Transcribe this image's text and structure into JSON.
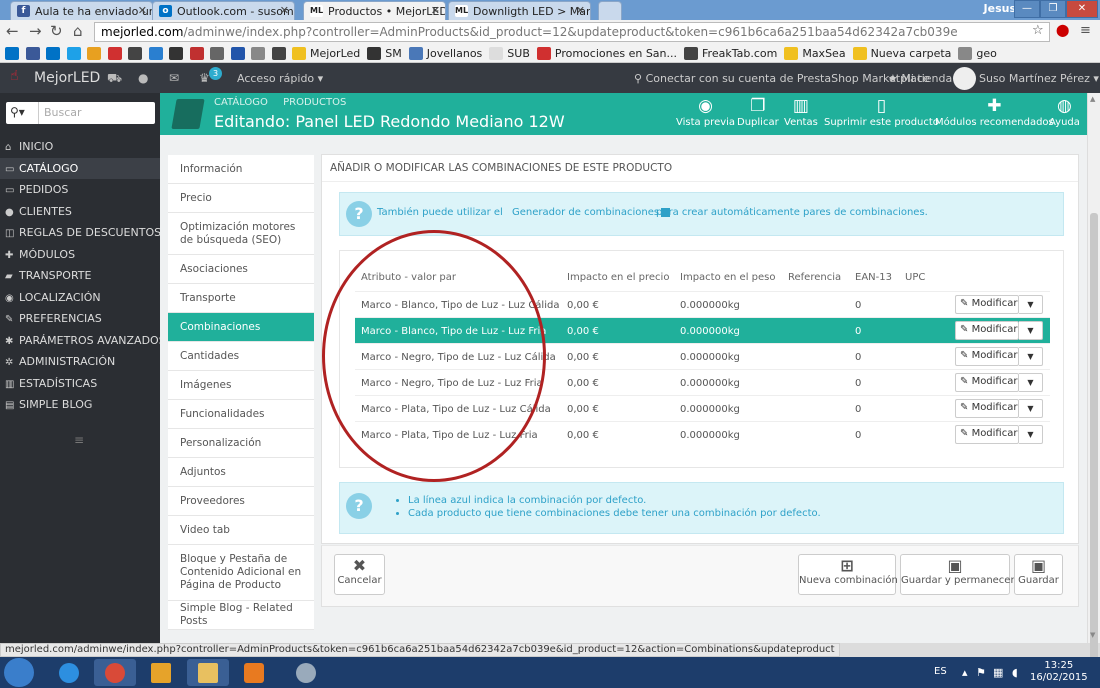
{
  "browser": {
    "tabs": [
      {
        "label": "Aula te ha enviado un me",
        "icon": "facebook-icon",
        "color": "#3b5998",
        "glyph": "f"
      },
      {
        "label": "Outlook.com - susomarp",
        "icon": "outlook-icon",
        "color": "#0072c6",
        "glyph": "o"
      },
      {
        "label": "Productos • MejorLED",
        "icon": "mejorled-icon",
        "color": "#ffffff",
        "glyph": "ML",
        "active": true
      },
      {
        "label": "Downligth LED > Marco b",
        "icon": "mejorled-icon",
        "color": "#ffffff",
        "glyph": "ML"
      }
    ],
    "window_user": "Jesus",
    "url": {
      "host": "mejorled.com",
      "rest": "/adminwe/index.php?controller=AdminProducts&id_product=12&updateproduct&token=c961b6ca6a251baa54d62342a7cb039e"
    },
    "bookmarks": [
      {
        "label": "MejorLed",
        "color": "#f0c020"
      },
      {
        "label": "SM",
        "color": "#333333"
      },
      {
        "label": "Jovellanos",
        "color": "#4a78b8"
      },
      {
        "label": "SUB",
        "color": "#dddddd"
      },
      {
        "label": "Promociones en San...",
        "color": "#d03030"
      },
      {
        "label": "FreakTab.com",
        "color": "#444444"
      },
      {
        "label": "MaxSea",
        "color": "#f0c020"
      },
      {
        "label": "Nueva carpeta",
        "color": "#f0c020"
      },
      {
        "label": "geo",
        "color": "#888888"
      }
    ],
    "status_url": "mejorled.com/adminwe/index.php?controller=AdminProducts&token=c961b6ca6a251baa54d62342a7cb039e&id_product=12&action=Combinations&updateproduct"
  },
  "header": {
    "shop_name": "MejorLED",
    "badge": "3",
    "quick_access": "Acceso rápido",
    "connect": "Conectar con su cuenta de PrestaShop Marketplace",
    "my_store": "Mi tienda",
    "user": "Suso Martínez Pérez"
  },
  "sidebar": {
    "search_placeholder": "Buscar",
    "items": [
      {
        "label": "INICIO",
        "icon": "home-icon",
        "glyph": "⌂"
      },
      {
        "label": "CATÁLOGO",
        "icon": "catalog-icon",
        "glyph": "▭",
        "active": true
      },
      {
        "label": "PEDIDOS",
        "icon": "credit-card-icon",
        "glyph": "▭"
      },
      {
        "label": "CLIENTES",
        "icon": "users-icon",
        "glyph": "●"
      },
      {
        "label": "REGLAS DE DESCUENTOS",
        "icon": "discount-icon",
        "glyph": "◫"
      },
      {
        "label": "MÓDULOS",
        "icon": "puzzle-icon",
        "glyph": "✚"
      },
      {
        "label": "TRANSPORTE",
        "icon": "truck-icon",
        "glyph": "▰"
      },
      {
        "label": "LOCALIZACIÓN",
        "icon": "globe-icon",
        "glyph": "◉"
      },
      {
        "label": "PREFERENCIAS",
        "icon": "wrench-icon",
        "glyph": "✎"
      },
      {
        "label": "PARÁMETROS AVANZADOS",
        "icon": "cogs-icon",
        "glyph": "✱"
      },
      {
        "label": "ADMINISTRACIÓN",
        "icon": "cog-icon",
        "glyph": "✲"
      },
      {
        "label": "ESTADÍSTICAS",
        "icon": "bar-chart-icon",
        "glyph": "▥"
      },
      {
        "label": "SIMPLE BLOG",
        "icon": "blog-icon",
        "glyph": "▤"
      }
    ]
  },
  "page": {
    "breadcrumb": [
      "CATÁLOGO",
      "PRODUCTOS"
    ],
    "title": "Editando: Panel LED Redondo Mediano 12W",
    "toolbar": [
      {
        "label": "Vista previa",
        "icon": "eye-icon",
        "glyph": "◉"
      },
      {
        "label": "Duplicar",
        "icon": "copy-icon",
        "glyph": "❐"
      },
      {
        "label": "Ventas",
        "icon": "bar-chart-icon",
        "glyph": "▥"
      },
      {
        "label": "Suprimir este producto",
        "icon": "trash-icon",
        "glyph": "▯"
      },
      {
        "label": "Módulos recomendados",
        "icon": "puzzle-icon",
        "glyph": "✚"
      },
      {
        "label": "Ayuda",
        "icon": "help-icon",
        "glyph": "◍"
      }
    ]
  },
  "subtabs": [
    {
      "label": "Información"
    },
    {
      "label": "Precio"
    },
    {
      "label": "Optimización motores de búsqueda (SEO)"
    },
    {
      "label": "Asociaciones"
    },
    {
      "label": "Transporte"
    },
    {
      "label": "Combinaciones",
      "active": true
    },
    {
      "label": "Cantidades"
    },
    {
      "label": "Imágenes"
    },
    {
      "label": "Funcionalidades"
    },
    {
      "label": "Personalización"
    },
    {
      "label": "Adjuntos"
    },
    {
      "label": "Proveedores"
    },
    {
      "label": "Video tab"
    },
    {
      "label": "Bloque y Pestaña de Contenido Adicional en Página de Producto"
    },
    {
      "label": "Simple Blog - Related Posts"
    }
  ],
  "panel": {
    "title": "AÑADIR O MODIFICAR LAS COMBINACIONES DE ESTE PRODUCTO",
    "info_text": "También puede utilizar el",
    "info_link": "Generador de combinaciones",
    "info_text2": "para crear automáticamente pares de combinaciones.",
    "columns": [
      "Atributo - valor par",
      "Impacto en el precio",
      "Impacto en el peso",
      "Referencia",
      "EAN-13",
      "UPC"
    ],
    "modify_label": "Modificar",
    "rows": [
      {
        "attribute": "Marco - Blanco, Tipo de Luz - Luz Cálida",
        "price": "0,00 €",
        "weight": "0.000000kg",
        "reference": "",
        "ean": "0",
        "upc": "",
        "default": false
      },
      {
        "attribute": "Marco - Blanco, Tipo de Luz - Luz Fria",
        "price": "0,00 €",
        "weight": "0.000000kg",
        "reference": "",
        "ean": "0",
        "upc": "",
        "default": true
      },
      {
        "attribute": "Marco - Negro, Tipo de Luz - Luz Cálida",
        "price": "0,00 €",
        "weight": "0.000000kg",
        "reference": "",
        "ean": "0",
        "upc": "",
        "default": false
      },
      {
        "attribute": "Marco - Negro, Tipo de Luz - Luz Fria",
        "price": "0,00 €",
        "weight": "0.000000kg",
        "reference": "",
        "ean": "0",
        "upc": "",
        "default": false
      },
      {
        "attribute": "Marco - Plata, Tipo de Luz - Luz Cálida",
        "price": "0,00 €",
        "weight": "0.000000kg",
        "reference": "",
        "ean": "0",
        "upc": "",
        "default": false
      },
      {
        "attribute": "Marco - Plata, Tipo de Luz - Luz Fria",
        "price": "0,00 €",
        "weight": "0.000000kg",
        "reference": "",
        "ean": "0",
        "upc": "",
        "default": false
      }
    ],
    "notes": [
      "La línea azul indica la combinación por defecto.",
      "Cada producto que tiene combinaciones debe tener una combinación por defecto."
    ],
    "buttons": {
      "cancel": "Cancelar",
      "new_combination": "Nueva combinación",
      "save_stay": "Guardar y permanecer",
      "save": "Guardar"
    }
  },
  "taskbar": {
    "lang": "ES",
    "time": "13:25",
    "date": "16/02/2015"
  },
  "colors": {
    "accent": "#20b09b",
    "info_blue": "#2ea1c8",
    "annotation_red": "#b02222"
  }
}
